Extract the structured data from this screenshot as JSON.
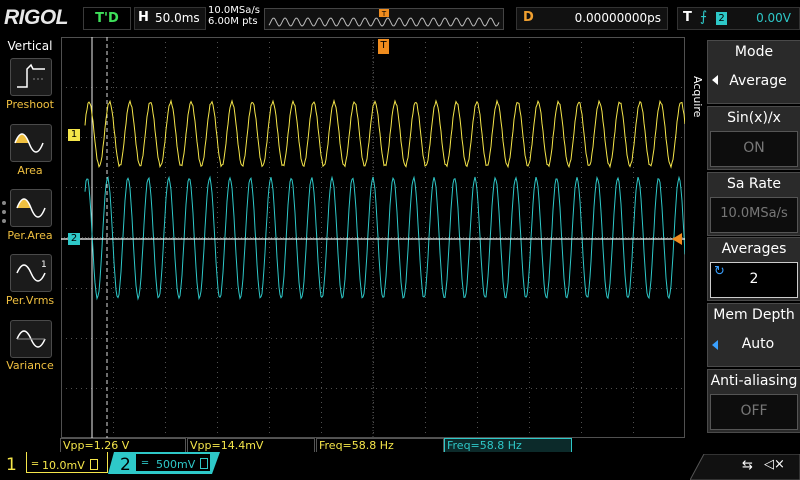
{
  "header": {
    "logo": "RIGOL",
    "trigger_status": "T'D",
    "horizontal_label": "H",
    "timebase": "50.0ms",
    "sample_rate": "10.0MSa/s",
    "memory_points": "6.00M pts",
    "delay_label": "D",
    "delay_value": "0.00000000ps",
    "trigger_label": "T",
    "trigger_source": "2",
    "trigger_level": "0.00V"
  },
  "left_menu": {
    "title": "Vertical",
    "items": [
      {
        "label": "Preshoot",
        "icon": "preshoot-icon"
      },
      {
        "label": "Area",
        "icon": "area-icon"
      },
      {
        "label": "Per.Area",
        "icon": "per-area-icon"
      },
      {
        "label": "Per.Vrms",
        "icon": "per-vrms-icon"
      },
      {
        "label": "Variance",
        "icon": "variance-icon"
      }
    ]
  },
  "right_menu": {
    "section": "Acquire",
    "items": [
      {
        "title": "Mode",
        "value": "Average",
        "enabled": true,
        "marker": "left-arrow"
      },
      {
        "title": "Sin(x)/x",
        "value": "ON",
        "enabled": false
      },
      {
        "title": "Sa Rate",
        "value": "10.0MSa/s",
        "enabled": false
      },
      {
        "title": "Averages",
        "value": "2",
        "enabled": true,
        "marker": "rotate"
      },
      {
        "title": "Mem Depth",
        "value": "Auto",
        "enabled": true,
        "marker": "left-arrow"
      },
      {
        "title": "Anti-aliasing",
        "value": "OFF",
        "enabled": false
      }
    ]
  },
  "markers": {
    "ch1": "1",
    "ch2": "2",
    "trigger_top": "T"
  },
  "measurements": [
    {
      "text": "Vpp=1.26 V",
      "channel": 1
    },
    {
      "text": "Vpp=14.4mV",
      "channel": 1
    },
    {
      "text": "Freq=58.8 Hz",
      "channel": 1
    },
    {
      "text": "Freq=58.8 Hz",
      "channel": 2
    }
  ],
  "channels": {
    "ch1": {
      "number": "1",
      "scale": "10.0mV",
      "color": "#f5e64a"
    },
    "ch2": {
      "number": "2",
      "scale": "500mV",
      "color": "#2ec8c8"
    }
  },
  "colors": {
    "ch1": "#f5e64a",
    "ch2": "#2ec8c8",
    "trigger": "#f08c1e",
    "grid": "#505050"
  },
  "waveforms": {
    "ch1_cycles_per_screen": 29.4,
    "ch2_cycles_per_screen": 29.4
  }
}
